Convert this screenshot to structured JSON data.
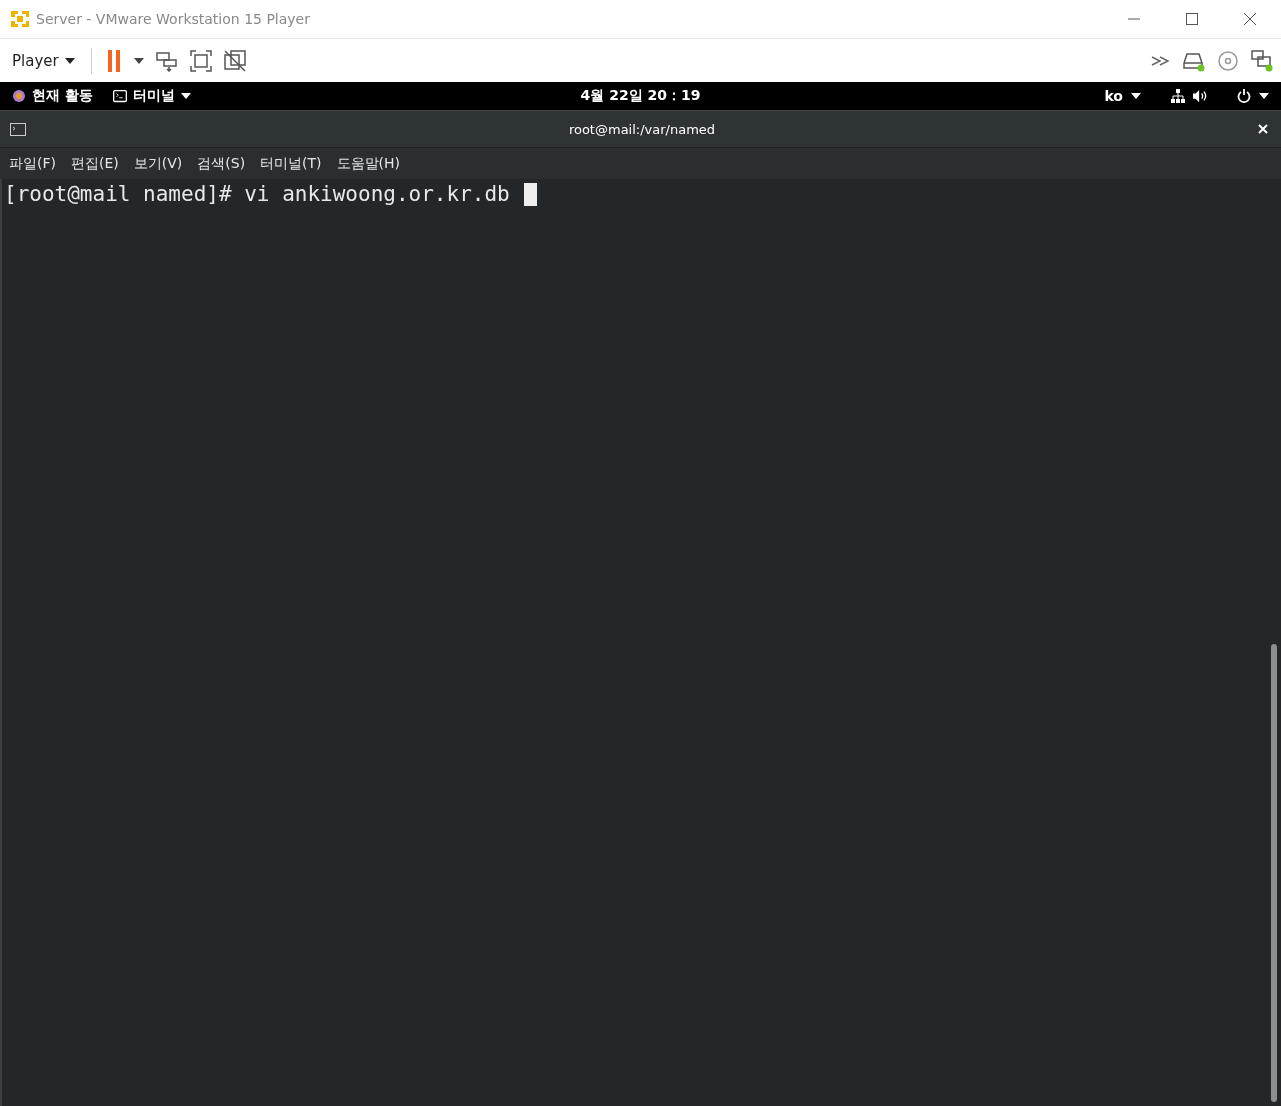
{
  "window": {
    "title": "Server - VMware Workstation 15 Player"
  },
  "toolbar": {
    "player_menu": "Player"
  },
  "top_bar": {
    "activities": "현재 활동",
    "app_menu": "터미널",
    "clock": "4월 22일  20：19",
    "input_source": "ko"
  },
  "terminal": {
    "title": "root@mail:/var/named",
    "menus": [
      {
        "label": "파일(F)"
      },
      {
        "label": "편집(E)"
      },
      {
        "label": "보기(V)"
      },
      {
        "label": "검색(S)"
      },
      {
        "label": "터미널(T)"
      },
      {
        "label": "도움말(H)"
      }
    ],
    "lines": [
      "[root@mail named]# vi ankiwoong.or.kr.db "
    ]
  }
}
